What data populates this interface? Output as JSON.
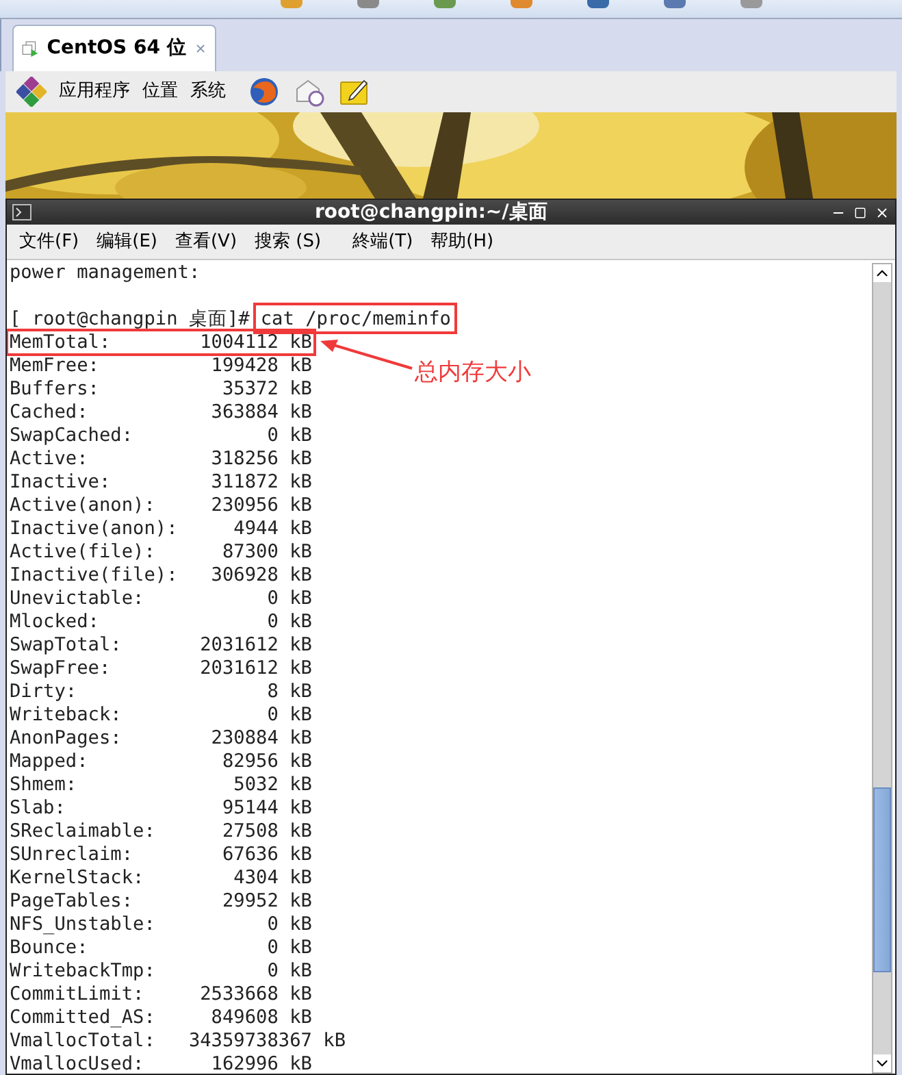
{
  "tab": {
    "title": "CentOS 64 位",
    "selected": true
  },
  "panel": {
    "menus": [
      "应用程序",
      "位置",
      "系统"
    ]
  },
  "terminal": {
    "title": "root@changpin:~/桌面",
    "menu": [
      "文件(F)",
      "编辑(E)",
      "查看(V)",
      "搜索 (S)",
      "終端(T)",
      "帮助(H)"
    ],
    "lines_before": [
      "power management:"
    ],
    "prompt": "[ root@changpin 桌面]#",
    "command": "cat /proc/meminfo",
    "rows": [
      {
        "name": "MemTotal:",
        "value": "1004112",
        "unit": "kB"
      },
      {
        "name": "MemFree:",
        "value": "199428",
        "unit": "kB"
      },
      {
        "name": "Buffers:",
        "value": "35372",
        "unit": "kB"
      },
      {
        "name": "Cached:",
        "value": "363884",
        "unit": "kB"
      },
      {
        "name": "SwapCached:",
        "value": "0",
        "unit": "kB"
      },
      {
        "name": "Active:",
        "value": "318256",
        "unit": "kB"
      },
      {
        "name": "Inactive:",
        "value": "311872",
        "unit": "kB"
      },
      {
        "name": "Active(anon):",
        "value": "230956",
        "unit": "kB"
      },
      {
        "name": "Inactive(anon):",
        "value": "4944",
        "unit": "kB"
      },
      {
        "name": "Active(file):",
        "value": "87300",
        "unit": "kB"
      },
      {
        "name": "Inactive(file):",
        "value": "306928",
        "unit": "kB"
      },
      {
        "name": "Unevictable:",
        "value": "0",
        "unit": "kB"
      },
      {
        "name": "Mlocked:",
        "value": "0",
        "unit": "kB"
      },
      {
        "name": "SwapTotal:",
        "value": "2031612",
        "unit": "kB"
      },
      {
        "name": "SwapFree:",
        "value": "2031612",
        "unit": "kB"
      },
      {
        "name": "Dirty:",
        "value": "8",
        "unit": "kB"
      },
      {
        "name": "Writeback:",
        "value": "0",
        "unit": "kB"
      },
      {
        "name": "AnonPages:",
        "value": "230884",
        "unit": "kB"
      },
      {
        "name": "Mapped:",
        "value": "82956",
        "unit": "kB"
      },
      {
        "name": "Shmem:",
        "value": "5032",
        "unit": "kB"
      },
      {
        "name": "Slab:",
        "value": "95144",
        "unit": "kB"
      },
      {
        "name": "SReclaimable:",
        "value": "27508",
        "unit": "kB"
      },
      {
        "name": "SUnreclaim:",
        "value": "67636",
        "unit": "kB"
      },
      {
        "name": "KernelStack:",
        "value": "4304",
        "unit": "kB"
      },
      {
        "name": "PageTables:",
        "value": "29952",
        "unit": "kB"
      },
      {
        "name": "NFS_Unstable:",
        "value": "0",
        "unit": "kB"
      },
      {
        "name": "Bounce:",
        "value": "0",
        "unit": "kB"
      },
      {
        "name": "WritebackTmp:",
        "value": "0",
        "unit": "kB"
      },
      {
        "name": "CommitLimit:",
        "value": "2533668",
        "unit": "kB"
      },
      {
        "name": "Committed_AS:",
        "value": "849608",
        "unit": "kB"
      },
      {
        "name": "VmallocTotal:",
        "value": "34359738367",
        "unit": "kB"
      },
      {
        "name": "VmallocUsed:",
        "value": "162996",
        "unit": "kB"
      }
    ]
  },
  "annotation": {
    "label": "总内存大小"
  }
}
